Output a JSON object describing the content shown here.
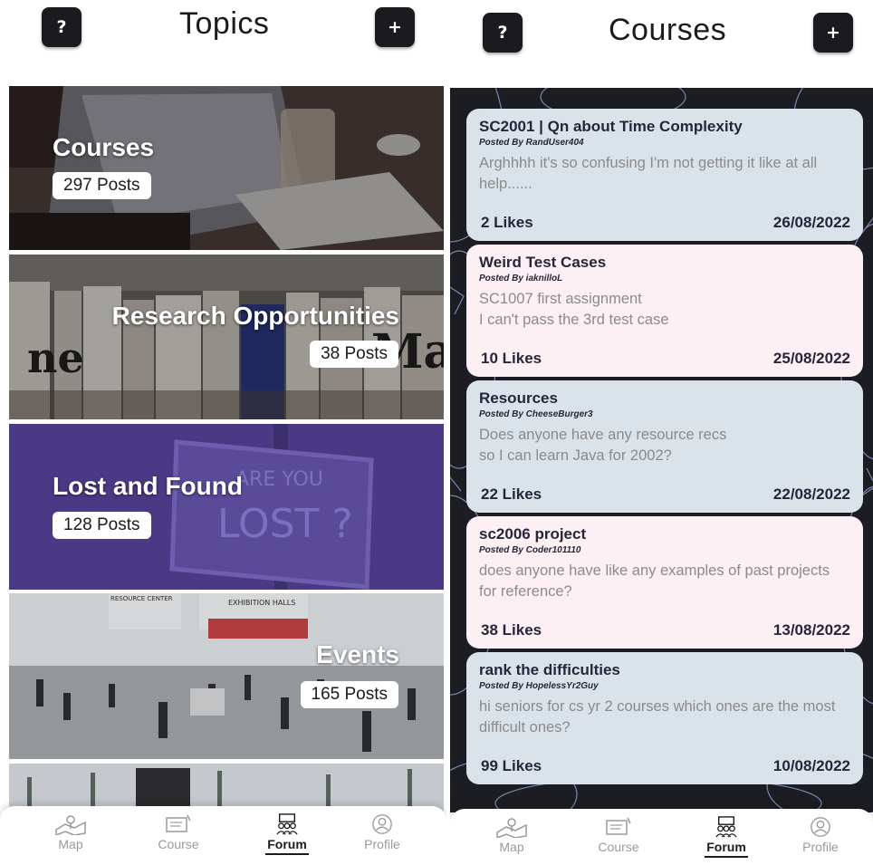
{
  "topics_screen": {
    "help_icon": "?",
    "title": "Topics",
    "add_icon": "+",
    "topics": [
      {
        "name": "Courses",
        "count": "297 Posts"
      },
      {
        "name": "Research Opportunities",
        "count": "38 Posts"
      },
      {
        "name": "Lost and Found",
        "count": "128 Posts"
      },
      {
        "name": "Events",
        "count": "165 Posts"
      }
    ],
    "sign_text_1": "ARE YOU",
    "sign_text_2": "LOST ?",
    "events_sign_1": "EXHIBITION HALLS",
    "events_sign_2": "RESOURCE CENTER",
    "newspaper_word": "MAT"
  },
  "courses_screen": {
    "help_icon": "?",
    "title": "Courses",
    "add_icon": "+",
    "posts": [
      {
        "title": "SC2001 | Qn about Time Complexity",
        "author": "Posted By RandUser404",
        "body": "Arghhhh it's so confusing I'm not getting it like at all help......",
        "likes": "2 Likes",
        "date": "26/08/2022"
      },
      {
        "title": "Weird Test Cases",
        "author": "Posted By iaknilloL",
        "body": "SC1007 first assignment\nI can't pass the 3rd test case",
        "likes": "10 Likes",
        "date": "25/08/2022"
      },
      {
        "title": "Resources",
        "author": "Posted By CheeseBurger3",
        "body": "Does anyone have any resource recs\nso I can  learn Java for 2002?",
        "likes": "22 Likes",
        "date": "22/08/2022"
      },
      {
        "title": "sc2006 project",
        "author": "Posted By Coder101110",
        "body": "does anyone have like any examples of past projects for reference?",
        "likes": "38 Likes",
        "date": "13/08/2022"
      },
      {
        "title": "rank the difficulties",
        "author": "Posted By HopelessYr2Guy",
        "body": "hi seniors for cs yr 2 courses which ones are the most difficult ones?",
        "likes": "99 Likes",
        "date": "10/08/2022"
      }
    ]
  },
  "nav": {
    "items": [
      {
        "label": "Map",
        "icon": "map-icon"
      },
      {
        "label": "Course",
        "icon": "course-icon"
      },
      {
        "label": "Forum",
        "icon": "forum-icon"
      },
      {
        "label": "Profile",
        "icon": "profile-icon"
      }
    ],
    "active": "Forum"
  },
  "colors": {
    "button_dark": "#1b1b1f",
    "card_blue": "#dbe3ea",
    "card_pink": "#fcf0f5",
    "lost_purple": "#4a3a86"
  }
}
